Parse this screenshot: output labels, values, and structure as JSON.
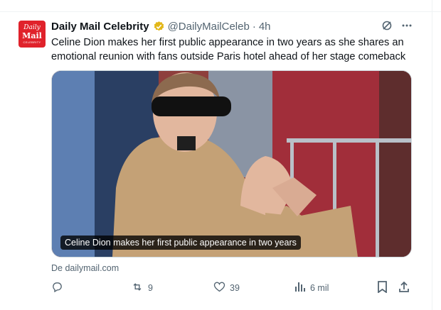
{
  "account": {
    "avatar_line1": "Daily",
    "avatar_line2": "Mail",
    "avatar_line3": "CELEBRITY",
    "name": "Daily Mail Celebrity",
    "handle": "@DailyMailCeleb",
    "separator": "·",
    "time": "4h"
  },
  "tweet": {
    "text": "Celine Dion makes her first public appearance in two years as she shares an emotional reunion with fans outside Paris hotel ahead of her stage comeback"
  },
  "card": {
    "caption": "Celine Dion makes her first public appearance in two years",
    "source": "De dailymail.com"
  },
  "actions": {
    "retweets": "9",
    "likes": "39",
    "views": "6 mil"
  },
  "colors": {
    "brand": "#e0222b",
    "verified_gold": "#e2b719",
    "muted": "#536471"
  }
}
